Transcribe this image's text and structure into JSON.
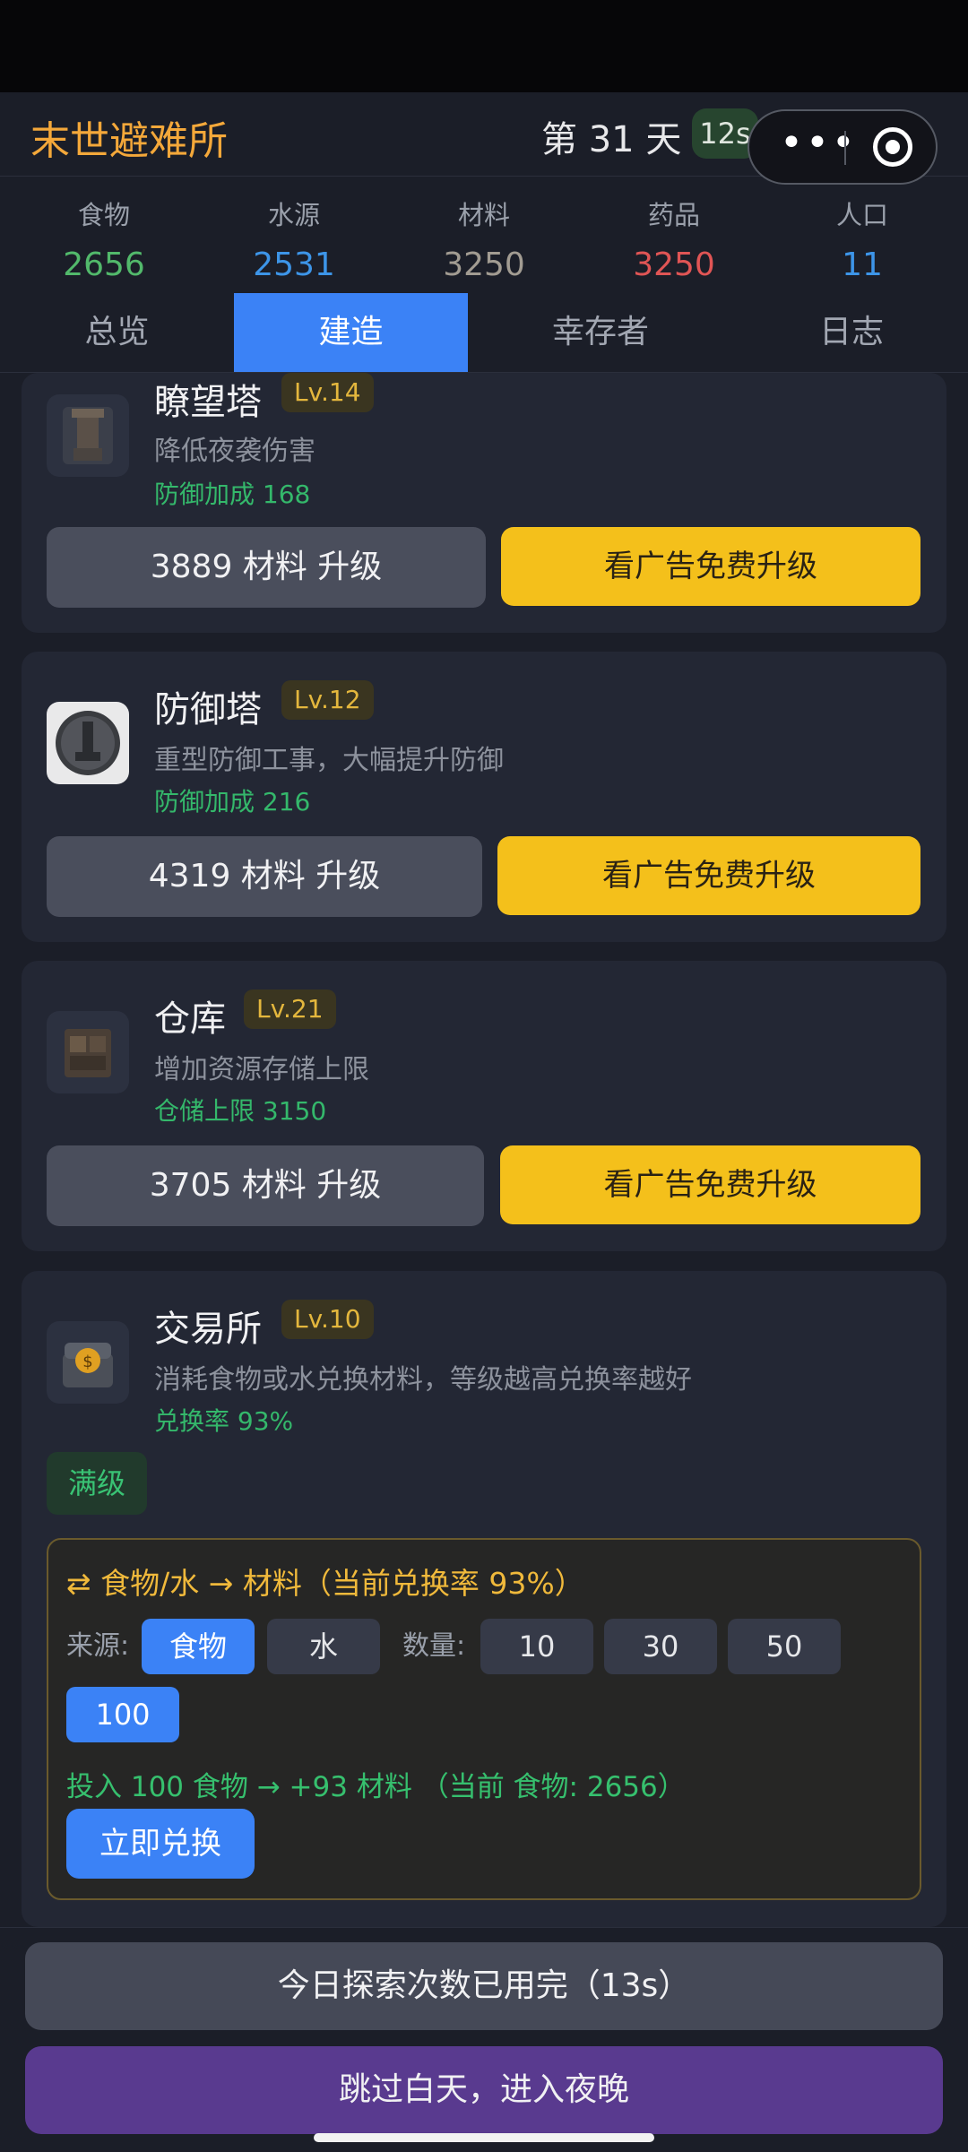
{
  "header": {
    "title": "末世避难所",
    "day": "第 31 天",
    "timer": "12s"
  },
  "capsule": {
    "more_icon": "more-dots-icon",
    "close_icon": "target-circle-icon"
  },
  "resources": [
    {
      "label": "食物",
      "value": "2656",
      "color": "#52b96b"
    },
    {
      "label": "水源",
      "value": "2531",
      "color": "#3d95e8"
    },
    {
      "label": "材料",
      "value": "3250",
      "color": "#a29c92"
    },
    {
      "label": "药品",
      "value": "3250",
      "color": "#e05555"
    },
    {
      "label": "人口",
      "value": "11",
      "color": "#3d95e8"
    }
  ],
  "tabs": [
    {
      "label": "总览"
    },
    {
      "label": "建造"
    },
    {
      "label": "幸存者"
    },
    {
      "label": "日志"
    }
  ],
  "buildings": [
    {
      "name": "瞭望塔",
      "level": "Lv.14",
      "desc": "降低夜袭伤害",
      "bonus": "防御加成 168",
      "upgrade": "3889 材料 升级",
      "ad": "看广告免费升级",
      "icon": "watchtower-icon"
    },
    {
      "name": "防御塔",
      "level": "Lv.12",
      "desc": "重型防御工事，大幅提升防御",
      "bonus": "防御加成 216",
      "upgrade": "4319 材料 升级",
      "ad": "看广告免费升级",
      "icon": "defense-tower-icon"
    },
    {
      "name": "仓库",
      "level": "Lv.21",
      "desc": "增加资源存储上限",
      "bonus": "仓储上限 3150",
      "upgrade": "3705 材料 升级",
      "ad": "看广告免费升级",
      "icon": "warehouse-icon"
    },
    {
      "name": "交易所",
      "level": "Lv.10",
      "desc": "消耗食物或水兑换材料，等级越高兑换率越好",
      "bonus": "兑换率 93%",
      "max_label": "满级",
      "icon": "exchange-chest-icon"
    }
  ],
  "exchange": {
    "title": "⇄ 食物/水 → 材料（当前兑换率 93%）",
    "source_label": "来源:",
    "sources": [
      "食物",
      "水"
    ],
    "selected_source": "食物",
    "qty_label": "数量:",
    "quantities": [
      "10",
      "30",
      "50",
      "100"
    ],
    "selected_qty": "100",
    "preview": "投入 100 食物 → +93 材料 （当前 食物: 2656）",
    "button": "立即兑换"
  },
  "bottom": {
    "explore": "今日探索次数已用完（13s）",
    "skip": "跳过白天，进入夜晚"
  }
}
